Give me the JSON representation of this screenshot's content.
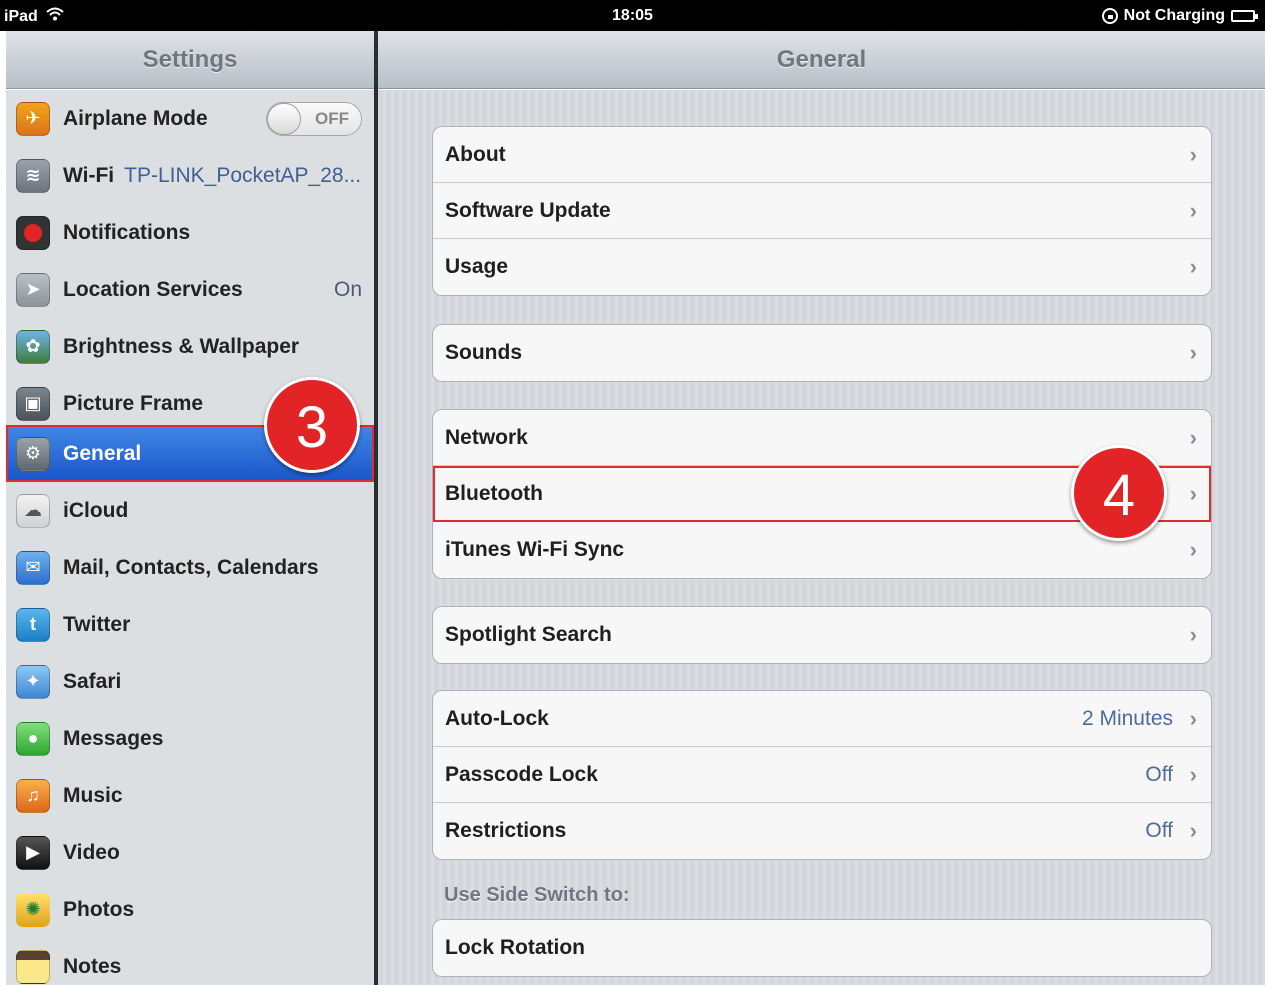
{
  "status_bar": {
    "device": "iPad",
    "time": "18:05",
    "charging": "Not Charging"
  },
  "left_nav": {
    "title": "Settings"
  },
  "right_nav": {
    "title": "General"
  },
  "sidebar": {
    "airplane": {
      "label": "Airplane Mode",
      "toggle": "OFF"
    },
    "wifi": {
      "label": "Wi-Fi",
      "value": "TP-LINK_PocketAP_28..."
    },
    "notifications": {
      "label": "Notifications"
    },
    "location": {
      "label": "Location Services",
      "value": "On"
    },
    "brightness": {
      "label": "Brightness & Wallpaper"
    },
    "picture_frame": {
      "label": "Picture Frame"
    },
    "general": {
      "label": "General"
    },
    "icloud": {
      "label": "iCloud"
    },
    "mail": {
      "label": "Mail, Contacts, Calendars"
    },
    "twitter": {
      "label": "Twitter"
    },
    "safari": {
      "label": "Safari"
    },
    "messages": {
      "label": "Messages"
    },
    "music": {
      "label": "Music"
    },
    "video": {
      "label": "Video"
    },
    "photos": {
      "label": "Photos"
    },
    "notes": {
      "label": "Notes"
    }
  },
  "general": {
    "about": "About",
    "software_update": "Software Update",
    "usage": "Usage",
    "sounds": "Sounds",
    "network": "Network",
    "bluetooth": "Bluetooth",
    "itunes_sync": "iTunes Wi-Fi Sync",
    "spotlight": "Spotlight Search",
    "auto_lock": {
      "label": "Auto-Lock",
      "value": "2 Minutes"
    },
    "passcode": {
      "label": "Passcode Lock",
      "value": "Off"
    },
    "restrictions": {
      "label": "Restrictions",
      "value": "Off"
    },
    "side_switch_label": "Use Side Switch to:",
    "lock_rotation": "Lock Rotation",
    "chevron": "›"
  },
  "callouts": {
    "step3": "3",
    "step4": "4"
  },
  "colors": {
    "accent_red": "#e32427",
    "selected_blue": "#1b57c9"
  }
}
